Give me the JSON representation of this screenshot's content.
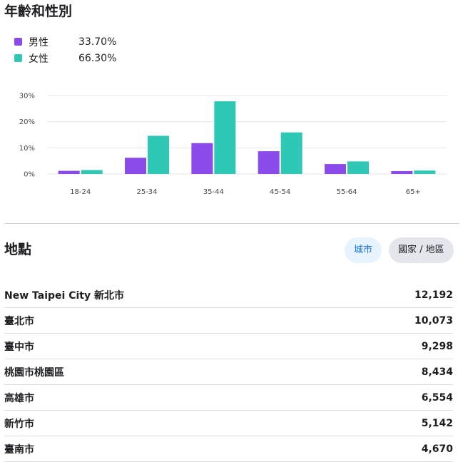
{
  "age_gender": {
    "title": "年齡和性別",
    "legend": [
      {
        "label": "男性",
        "value": "33.70%",
        "color": "#8a4bea"
      },
      {
        "label": "女性",
        "value": "66.30%",
        "color": "#2ec8b5"
      }
    ]
  },
  "chart_data": {
    "type": "bar",
    "categories": [
      "18-24",
      "25-34",
      "35-44",
      "45-54",
      "55-64",
      "65+"
    ],
    "series": [
      {
        "name": "男性",
        "values": [
          1.2,
          6.2,
          11.8,
          8.7,
          3.8,
          1.1
        ],
        "color": "#8a4bea"
      },
      {
        "name": "女性",
        "values": [
          1.5,
          14.6,
          27.8,
          15.9,
          4.8,
          1.3
        ],
        "color": "#2ec8b5"
      }
    ],
    "yticks": [
      "0%",
      "10%",
      "20%",
      "30%"
    ],
    "ylim": [
      0,
      30
    ],
    "grid": true
  },
  "location": {
    "title": "地點",
    "tabs": {
      "city": "城市",
      "country": "國家 / 地區"
    },
    "rows": [
      {
        "name": "New Taipei City 新北市",
        "value": "12,192"
      },
      {
        "name": "臺北市",
        "value": "10,073"
      },
      {
        "name": "臺中市",
        "value": "9,298"
      },
      {
        "name": "桃園市桃園區",
        "value": "8,434"
      },
      {
        "name": "高雄市",
        "value": "6,554"
      },
      {
        "name": "新竹市",
        "value": "5,142"
      },
      {
        "name": "臺南市",
        "value": "4,670"
      }
    ]
  }
}
